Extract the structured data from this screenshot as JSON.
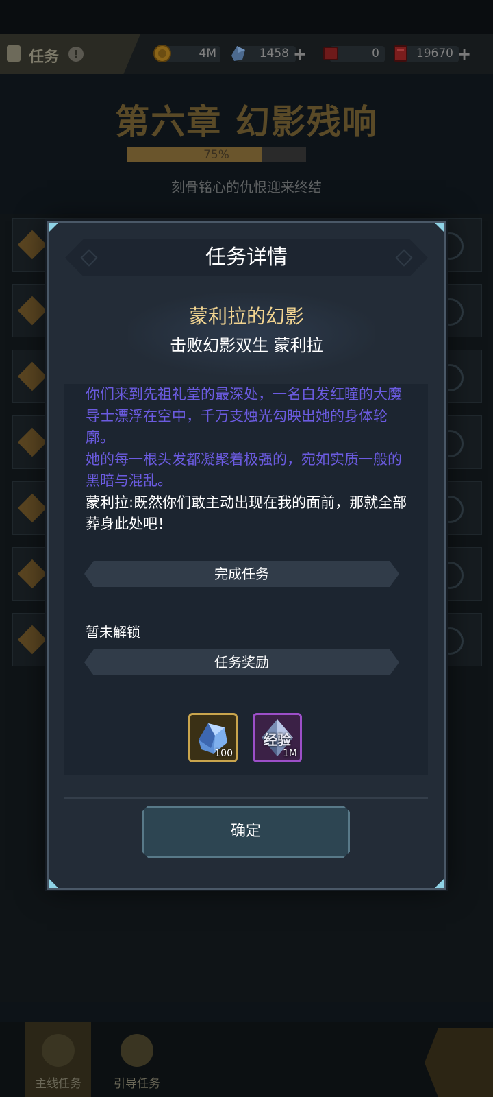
{
  "topbar": {
    "title": "任务",
    "info_glyph": "!",
    "resources": [
      {
        "icon": "gold-coin-icon",
        "value": "4M",
        "has_plus": false
      },
      {
        "icon": "crystal-icon",
        "value": "1458",
        "has_plus": true
      },
      {
        "icon": "red-ticket-icon",
        "value": "0",
        "has_plus": false
      },
      {
        "icon": "red-book-icon",
        "value": "19670",
        "has_plus": true
      }
    ],
    "plus_glyph": "+"
  },
  "chapter": {
    "title": "第六章 幻影残响",
    "progress_percent": 75,
    "progress_label": "75%",
    "subtitle": "刻骨铭心的仇恨迎来终结"
  },
  "modal": {
    "title": "任务详情",
    "quest_name": "蒙利拉的幻影",
    "quest_objective": "击败幻影双生 蒙利拉",
    "description": [
      {
        "kind": "narration",
        "text": "你们来到先祖礼堂的最深处，一名白发红瞳的大魔导士漂浮在空中，千万支烛光勾映出她的身体轮廓。"
      },
      {
        "kind": "narration",
        "text": "她的每一根头发都凝聚着极强的，宛如实质一般的黑暗与混乱。"
      },
      {
        "kind": "speech",
        "text": "蒙利拉:既然你们敢主动出现在我的面前，那就全部葬身此处吧！"
      }
    ],
    "complete_section": "完成任务",
    "locked_text": "暂未解锁",
    "reward_section": "任务奖励",
    "rewards": [
      {
        "icon": "crystal-icon",
        "count": "100",
        "rarity_color": "#c9a54d"
      },
      {
        "icon": "exp-crystal-icon",
        "label": "经验",
        "count": "1M",
        "rarity_color": "#9c4fc8"
      }
    ],
    "confirm_button": "确定"
  },
  "bottom_nav": {
    "items": [
      {
        "label": "主线任务",
        "active": true
      },
      {
        "label": "引导任务",
        "active": false
      }
    ]
  },
  "colors": {
    "accent_gold": "#f0d390",
    "narration_purple": "#6b5be0",
    "modal_bg": "#232c37",
    "corner_cyan": "#8fd3e6"
  }
}
